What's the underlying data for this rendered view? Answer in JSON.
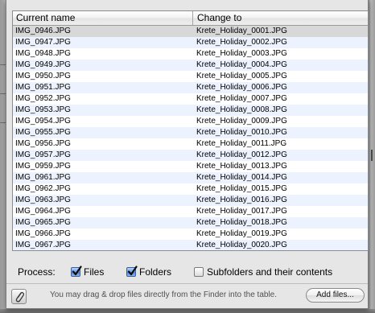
{
  "table": {
    "headers": {
      "current": "Current name",
      "change": "Change to"
    },
    "rows": [
      {
        "current": "IMG_0946.JPG",
        "change": "Krete_Holiday_0001.JPG"
      },
      {
        "current": "IMG_0947.JPG",
        "change": "Krete_Holiday_0002.JPG"
      },
      {
        "current": "IMG_0948.JPG",
        "change": "Krete_Holiday_0003.JPG"
      },
      {
        "current": "IMG_0949.JPG",
        "change": "Krete_Holiday_0004.JPG"
      },
      {
        "current": "IMG_0950.JPG",
        "change": "Krete_Holiday_0005.JPG"
      },
      {
        "current": "IMG_0951.JPG",
        "change": "Krete_Holiday_0006.JPG"
      },
      {
        "current": "IMG_0952.JPG",
        "change": "Krete_Holiday_0007.JPG"
      },
      {
        "current": "IMG_0953.JPG",
        "change": "Krete_Holiday_0008.JPG"
      },
      {
        "current": "IMG_0954.JPG",
        "change": "Krete_Holiday_0009.JPG"
      },
      {
        "current": "IMG_0955.JPG",
        "change": "Krete_Holiday_0010.JPG"
      },
      {
        "current": "IMG_0956.JPG",
        "change": "Krete_Holiday_0011.JPG"
      },
      {
        "current": "IMG_0957.JPG",
        "change": "Krete_Holiday_0012.JPG"
      },
      {
        "current": "IMG_0959.JPG",
        "change": "Krete_Holiday_0013.JPG"
      },
      {
        "current": "IMG_0961.JPG",
        "change": "Krete_Holiday_0014.JPG"
      },
      {
        "current": "IMG_0962.JPG",
        "change": "Krete_Holiday_0015.JPG"
      },
      {
        "current": "IMG_0963.JPG",
        "change": "Krete_Holiday_0016.JPG"
      },
      {
        "current": "IMG_0964.JPG",
        "change": "Krete_Holiday_0017.JPG"
      },
      {
        "current": "IMG_0965.JPG",
        "change": "Krete_Holiday_0018.JPG"
      },
      {
        "current": "IMG_0966.JPG",
        "change": "Krete_Holiday_0019.JPG"
      },
      {
        "current": "IMG_0967.JPG",
        "change": "Krete_Holiday_0020.JPG"
      }
    ],
    "selected_row": 0
  },
  "process": {
    "label": "Process:",
    "files": {
      "label": "Files",
      "checked": true
    },
    "folders": {
      "label": "Folders",
      "checked": true
    },
    "subfolders": {
      "label": "Subfolders and their contents",
      "checked": false
    }
  },
  "footer": {
    "attach_icon": "paperclip-icon",
    "hint": "You may drag & drop files directly from the Finder into the table.",
    "add_button": "Add files..."
  },
  "colors": {
    "row_alternate": "#edf3fe",
    "row_selected": "#d8d8d8",
    "checkbox_checked": "#4a80d4"
  }
}
